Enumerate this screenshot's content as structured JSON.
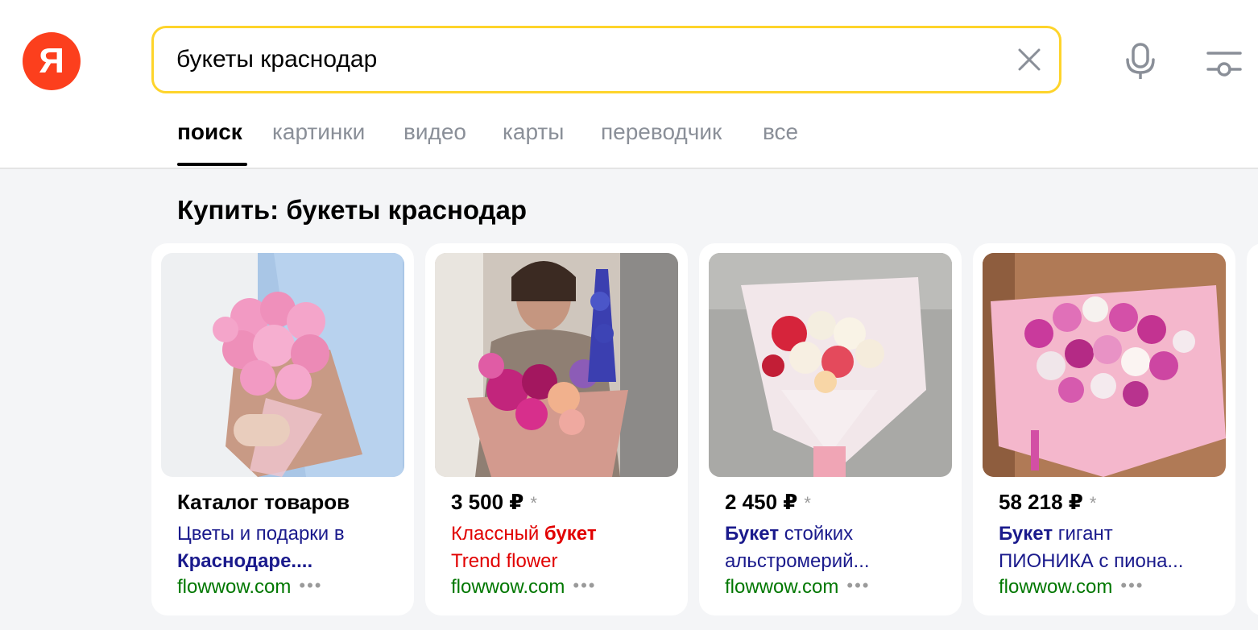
{
  "logo": {
    "letter": "Я"
  },
  "search": {
    "query": "букеты краснодар"
  },
  "tabs": [
    {
      "label": "поиск",
      "active": true
    },
    {
      "label": "картинки"
    },
    {
      "label": "видео"
    },
    {
      "label": "карты"
    },
    {
      "label": "переводчик"
    },
    {
      "label": "все"
    }
  ],
  "section": {
    "title": "Купить: букеты краснодар"
  },
  "cards": [
    {
      "title": "Каталог товаров",
      "desc_line1": "Цветы и подарки в",
      "desc_line2_bold": "Краснодаре....",
      "host": "flowwow.com",
      "more": "•••"
    },
    {
      "price": "3 500 ₽",
      "star": "*",
      "desc_line1_plain": "Классный ",
      "desc_line1_bold": "букет",
      "desc_line2": "Trend flower",
      "host": "flowwow.com",
      "more": "•••"
    },
    {
      "price": "2 450 ₽",
      "star": "*",
      "desc_line1_bold": "Букет",
      "desc_line1_plain": " стойких",
      "desc_line2": "альстромерий...",
      "host": "flowwow.com",
      "more": "•••"
    },
    {
      "price": "58 218 ₽",
      "star": "*",
      "desc_line1_bold": "Букет",
      "desc_line1_plain": " гигант",
      "desc_line2": "ПИОНИКА с пиона...",
      "host": "flowwow.com",
      "more": "•••"
    }
  ],
  "colors": {
    "brand_red": "#fc3f1d",
    "search_border": "#fed42b",
    "link_blue": "#1a1a8c",
    "host_green": "#007700",
    "ad_red": "#e10000"
  },
  "icons": [
    "clear-icon",
    "microphone-icon",
    "filters-icon"
  ]
}
